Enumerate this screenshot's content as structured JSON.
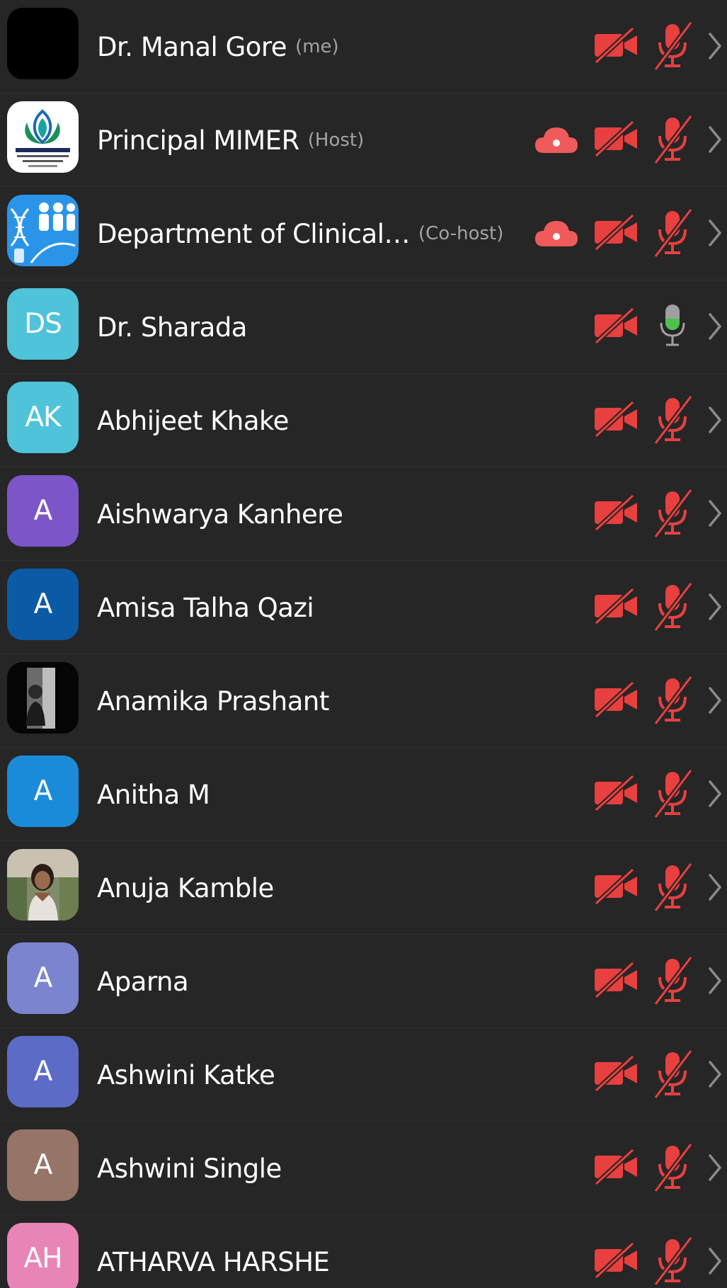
{
  "participants": [
    {
      "name": "Dr. Manal Gore",
      "role": "(me)",
      "avatar": {
        "kind": "blank",
        "color": "#000000"
      },
      "cloud": false,
      "mic": "muted",
      "video": "off"
    },
    {
      "name": "Principal MIMER",
      "role": "(Host)",
      "avatar": {
        "kind": "logo"
      },
      "cloud": true,
      "mic": "muted",
      "video": "off"
    },
    {
      "name": "Department of Clinical…",
      "role": "(Co-host)",
      "avatar": {
        "kind": "department"
      },
      "cloud": true,
      "mic": "muted",
      "video": "off"
    },
    {
      "name": "Dr. Sharada",
      "role": "",
      "avatar": {
        "kind": "initials",
        "initials": "DS",
        "color": "#4ec3d9"
      },
      "cloud": false,
      "mic": "active",
      "video": "off"
    },
    {
      "name": "Abhijeet Khake",
      "role": "",
      "avatar": {
        "kind": "initials",
        "initials": "AK",
        "color": "#4ec3d9"
      },
      "cloud": false,
      "mic": "muted",
      "video": "off"
    },
    {
      "name": "Aishwarya Kanhere",
      "role": "",
      "avatar": {
        "kind": "initials",
        "initials": "A",
        "color": "#7c56c8"
      },
      "cloud": false,
      "mic": "muted",
      "video": "off"
    },
    {
      "name": "Amisa Talha Qazi",
      "role": "",
      "avatar": {
        "kind": "initials",
        "initials": "A",
        "color": "#0b5aa6"
      },
      "cloud": false,
      "mic": "muted",
      "video": "off"
    },
    {
      "name": "Anamika Prashant",
      "role": "",
      "avatar": {
        "kind": "photo-dark"
      },
      "cloud": false,
      "mic": "muted",
      "video": "off"
    },
    {
      "name": "Anitha M",
      "role": "",
      "avatar": {
        "kind": "initials",
        "initials": "A",
        "color": "#1a8bd8"
      },
      "cloud": false,
      "mic": "muted",
      "video": "off"
    },
    {
      "name": "Anuja Kamble",
      "role": "",
      "avatar": {
        "kind": "photo-person"
      },
      "cloud": false,
      "mic": "muted",
      "video": "off"
    },
    {
      "name": "Aparna",
      "role": "",
      "avatar": {
        "kind": "initials",
        "initials": "A",
        "color": "#7b84cf"
      },
      "cloud": false,
      "mic": "muted",
      "video": "off"
    },
    {
      "name": "Ashwini Katke",
      "role": "",
      "avatar": {
        "kind": "initials",
        "initials": "A",
        "color": "#5c6bc6"
      },
      "cloud": false,
      "mic": "muted",
      "video": "off"
    },
    {
      "name": "Ashwini Single",
      "role": "",
      "avatar": {
        "kind": "initials",
        "initials": "A",
        "color": "#967468"
      },
      "cloud": false,
      "mic": "muted",
      "video": "off"
    },
    {
      "name": "ATHARVA HARSHE",
      "role": "",
      "avatar": {
        "kind": "initials",
        "initials": "AH",
        "color": "#e885b6"
      },
      "cloud": false,
      "mic": "muted",
      "video": "off"
    }
  ],
  "icons": {
    "video": "video-off-icon",
    "mic_muted": "mic-muted-icon",
    "mic_active": "mic-active-icon",
    "cloud": "cloud-record-icon",
    "chevron": "chevron-right-icon"
  },
  "colors": {
    "background": "#262626",
    "muted_red": "#e8403f",
    "cloud_red": "#f05a5a",
    "mic_active_green": "#4cc24c",
    "mic_active_gray": "#a0a0a0",
    "name_text": "#ffffff",
    "role_text": "#a3a3a3",
    "chevron": "#8a8a8a"
  }
}
